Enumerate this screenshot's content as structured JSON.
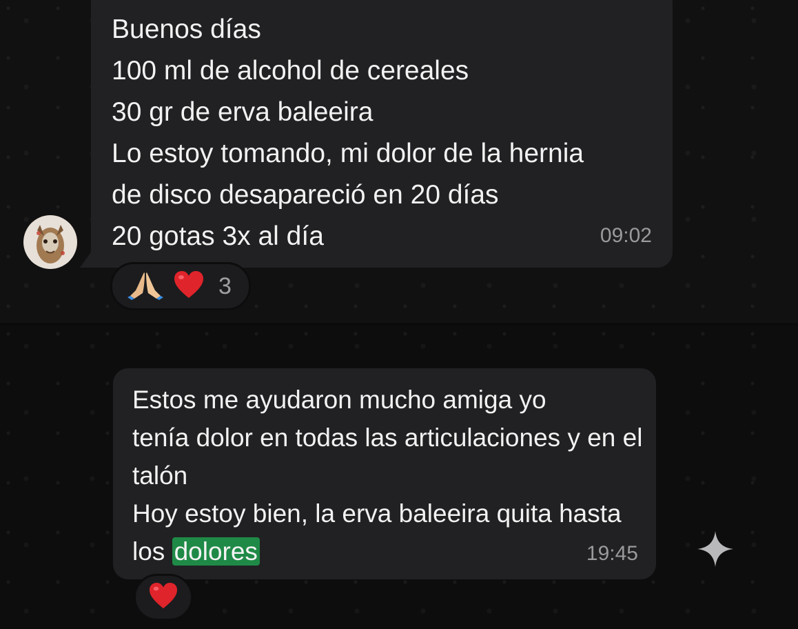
{
  "message_1": {
    "lines": [
      "Buenos días",
      "100 ml de alcohol de cereales",
      "30 gr de erva baleeira",
      "Lo estoy tomando, mi dolor de la hernia",
      "de disco desapareció en 20 días",
      "20 gotas 3x al día"
    ],
    "time": "09:02",
    "reactions": {
      "icons": [
        "folded-hands-icon",
        "red-heart-icon"
      ],
      "count": "3"
    }
  },
  "message_2": {
    "lines": [
      "Estos me ayudaron mucho amiga yo",
      "tenía dolor en todas las articulaciones y en el",
      "talón",
      "Hoy estoy bien, la erva baleeira quita hasta"
    ],
    "last_line_prefix": "los ",
    "highlighted_word": "dolores",
    "time": "19:45",
    "reactions": {
      "icons": [
        "red-heart-icon"
      ]
    }
  },
  "colors": {
    "bubble": "#212123",
    "background": "#111112",
    "highlight": "#1f8a47",
    "timestamp": "#9a9a9c",
    "heart": "#e0242b"
  }
}
